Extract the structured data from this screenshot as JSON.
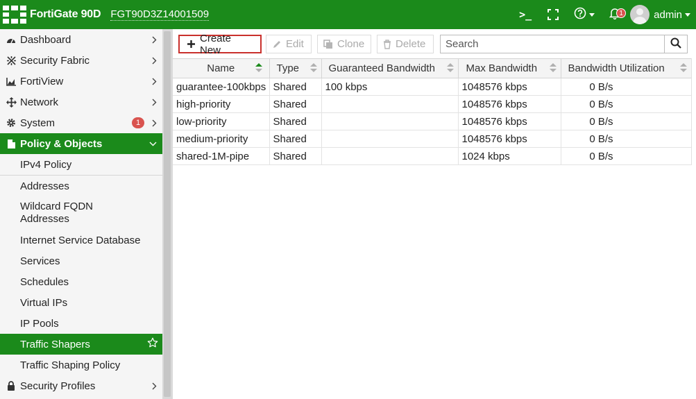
{
  "header": {
    "brand": "FortiGate 90D",
    "serial": "FGT90D3Z14001509",
    "console_glyph": ">_",
    "notifications_count": "1",
    "user": "admin",
    "accent_color": "#1b8a1b"
  },
  "sidebar": {
    "items": [
      {
        "label": "Dashboard",
        "icon": "dashboard-icon"
      },
      {
        "label": "Security Fabric",
        "icon": "fabric-icon"
      },
      {
        "label": "FortiView",
        "icon": "chart-icon"
      },
      {
        "label": "Network",
        "icon": "move-icon"
      },
      {
        "label": "System",
        "icon": "gear-icon",
        "badge": "1"
      },
      {
        "label": "Policy & Objects",
        "icon": "policy-icon"
      },
      {
        "label": "Security Profiles",
        "icon": "lock-icon"
      }
    ],
    "sub_items": [
      "IPv4 Policy",
      "Addresses",
      "Wildcard FQDN Addresses",
      "Internet Service Database",
      "Services",
      "Schedules",
      "Virtual IPs",
      "IP Pools",
      "Traffic Shapers",
      "Traffic Shaping Policy"
    ]
  },
  "toolbar": {
    "create_label": "Create New",
    "edit_label": "Edit",
    "clone_label": "Clone",
    "delete_label": "Delete",
    "search_placeholder": "Search"
  },
  "table": {
    "columns": [
      "Name",
      "Type",
      "Guaranteed Bandwidth",
      "Max Bandwidth",
      "Bandwidth Utilization"
    ],
    "rows": [
      [
        "guarantee-100kbps",
        "Shared",
        "100 kbps",
        "1048576 kbps",
        "0 B/s"
      ],
      [
        "high-priority",
        "Shared",
        "",
        "1048576 kbps",
        "0 B/s"
      ],
      [
        "low-priority",
        "Shared",
        "",
        "1048576 kbps",
        "0 B/s"
      ],
      [
        "medium-priority",
        "Shared",
        "",
        "1048576 kbps",
        "0 B/s"
      ],
      [
        "shared-1M-pipe",
        "Shared",
        "",
        "1024 kbps",
        "0 B/s"
      ]
    ]
  }
}
